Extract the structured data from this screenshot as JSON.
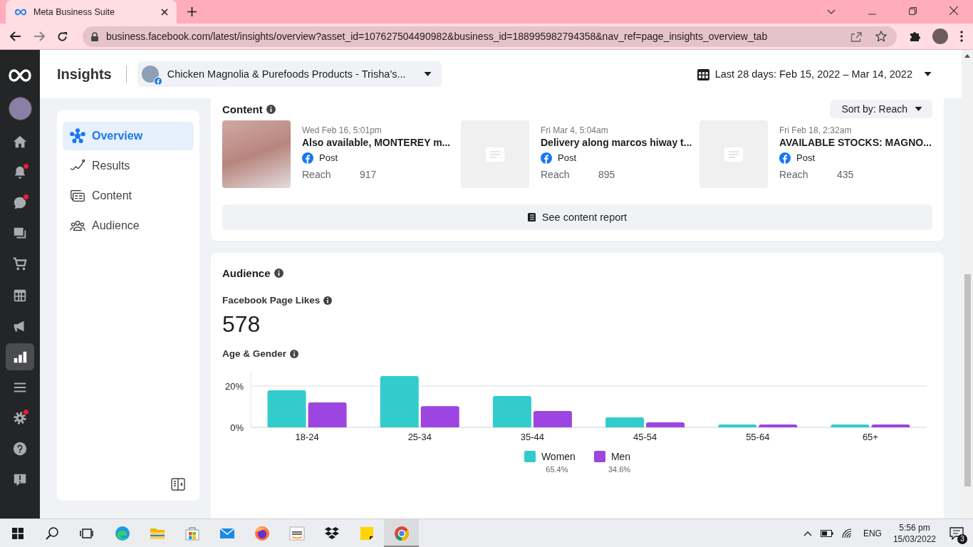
{
  "browser": {
    "tab_title": "Meta Business Suite",
    "url": "business.facebook.com/latest/insights/overview?asset_id=107627504490982&business_id=188995982794358&nav_ref=page_insights_overview_tab",
    "forward_disabled": true
  },
  "rail": [
    {
      "kind": "home",
      "selected": false,
      "badge": false
    },
    {
      "kind": "bell",
      "selected": false,
      "badge": true
    },
    {
      "kind": "chat",
      "selected": false,
      "badge": true
    },
    {
      "kind": "pages",
      "selected": false,
      "badge": false
    },
    {
      "kind": "cart",
      "selected": false,
      "badge": false
    },
    {
      "kind": "table",
      "selected": false,
      "badge": false
    },
    {
      "kind": "megaphone",
      "selected": false,
      "badge": false
    },
    {
      "kind": "chart",
      "selected": true,
      "badge": false
    },
    {
      "kind": "menu",
      "selected": false,
      "badge": false
    },
    {
      "kind": "gear",
      "selected": false,
      "badge": true
    },
    {
      "kind": "help",
      "selected": false,
      "badge": false
    },
    {
      "kind": "alert",
      "selected": false,
      "badge": false
    }
  ],
  "header": {
    "title": "Insights",
    "page_name": "Chicken Magnolia & Purefoods Products - Trisha's...",
    "date_range": "Last 28 days: Feb 15, 2022 – Mar 14, 2022"
  },
  "nav": [
    {
      "label": "Overview",
      "kind": "overview",
      "selected": true
    },
    {
      "label": "Results",
      "kind": "results",
      "selected": false
    },
    {
      "label": "Content",
      "kind": "content",
      "selected": false
    },
    {
      "label": "Audience",
      "kind": "audience",
      "selected": false
    }
  ],
  "content_section": {
    "title": "Content",
    "sort": "Sort by: Reach",
    "posts": [
      {
        "date": "Wed Feb 16, 5:01pm",
        "title": "Also available, MONTEREY m...",
        "type": "Post",
        "metric": "Reach",
        "value": "917",
        "kind": "photo"
      },
      {
        "date": "Fri Mar 4, 5:04am",
        "title": "Delivery along marcos hiway t...",
        "type": "Post",
        "metric": "Reach",
        "value": "895",
        "kind": "text"
      },
      {
        "date": "Fri Feb 18, 2:32am",
        "title": "AVAILABLE STOCKS: MAGNO...",
        "type": "Post",
        "metric": "Reach",
        "value": "435",
        "kind": "text"
      }
    ],
    "report_button": "See content report"
  },
  "audience_section": {
    "title": "Audience",
    "likes_label": "Facebook Page Likes",
    "likes_value": "578",
    "age_gender_label": "Age & Gender",
    "chart_data": {
      "type": "bar",
      "categories": [
        "18-24",
        "25-34",
        "35-44",
        "45-54",
        "55-64",
        "65+"
      ],
      "series": [
        {
          "name": "Women",
          "color": "#33cccc",
          "values": [
            17.9,
            24.8,
            15.2,
            4.8,
            1.4,
            1.4
          ]
        },
        {
          "name": "Men",
          "color": "#9c45e0",
          "values": [
            12.1,
            10.3,
            7.9,
            2.4,
            1.4,
            1.4
          ]
        }
      ],
      "ylim": [
        0,
        27
      ],
      "yticks": [
        {
          "value": 0,
          "label": "0%"
        },
        {
          "value": 20,
          "label": "20%"
        }
      ]
    },
    "legend": [
      {
        "share": "65.4%"
      },
      {
        "share": "34.6%"
      }
    ]
  },
  "taskbar": {
    "apps": [
      {
        "kind": "start",
        "selected": false
      },
      {
        "kind": "search",
        "selected": false
      },
      {
        "kind": "taskview",
        "selected": false
      },
      {
        "kind": "edge",
        "selected": false
      },
      {
        "kind": "folder",
        "selected": false
      },
      {
        "kind": "store",
        "selected": false
      },
      {
        "kind": "mail",
        "selected": false
      },
      {
        "kind": "firefox",
        "selected": false
      },
      {
        "kind": "shop",
        "selected": false
      },
      {
        "kind": "dropbox",
        "selected": false
      },
      {
        "kind": "sticky",
        "selected": false
      },
      {
        "kind": "chrome",
        "selected": true
      }
    ],
    "language": "ENG",
    "time": "5:56 pm",
    "date": "15/03/2022",
    "notifications": "3"
  }
}
